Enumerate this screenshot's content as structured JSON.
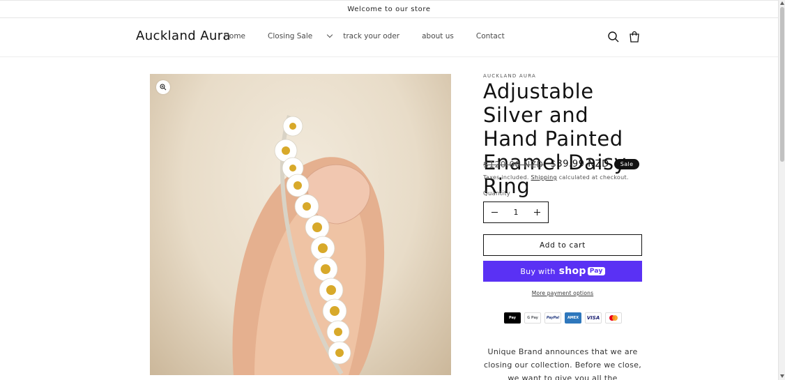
{
  "announcement": {
    "text": "Welcome to our store"
  },
  "header": {
    "logo": "Auckland Aura",
    "nav": [
      {
        "label": "Home"
      },
      {
        "label": "Closing Sale",
        "has_dropdown": true
      },
      {
        "label": "track your oder"
      },
      {
        "label": "about us"
      },
      {
        "label": "Contact"
      }
    ],
    "icons": [
      "search-icon",
      "cart-icon"
    ]
  },
  "product": {
    "vendor": "AUCKLAND AURA",
    "title": "Adjustable Silver and Hand Painted Enamel Daisy Ring",
    "price_old": "$120.00 NZD",
    "price_new": "$39.99 NZD",
    "badge": "Sale",
    "tax_prefix": "Taxes included.",
    "tax_link": "Shipping",
    "tax_suffix": "calculated at checkout.",
    "quantity_label": "Quantity",
    "quantity_value": "1",
    "add_to_cart": "Add to cart",
    "buy_with": "Buy with",
    "shop_pay_word": "shop",
    "shop_pay_badge": "Pay",
    "more_payment": "More payment options",
    "payment_icons": [
      {
        "name": "apple-pay-icon",
        "label": "Pay"
      },
      {
        "name": "google-pay-icon",
        "label": "G Pay"
      },
      {
        "name": "paypal-icon",
        "label": "PayPal"
      },
      {
        "name": "amex-icon",
        "label": "AMEX"
      },
      {
        "name": "visa-icon",
        "label": "VISA"
      },
      {
        "name": "mastercard-icon",
        "label": ""
      }
    ],
    "description": "Unique Brand announces that we are closing our collection. Before we close, we want to give you all the opportunity to shop with great"
  },
  "colors": {
    "accent_shop_pay": "#5a31f4",
    "badge_bg": "#121212",
    "text": "#121212"
  }
}
